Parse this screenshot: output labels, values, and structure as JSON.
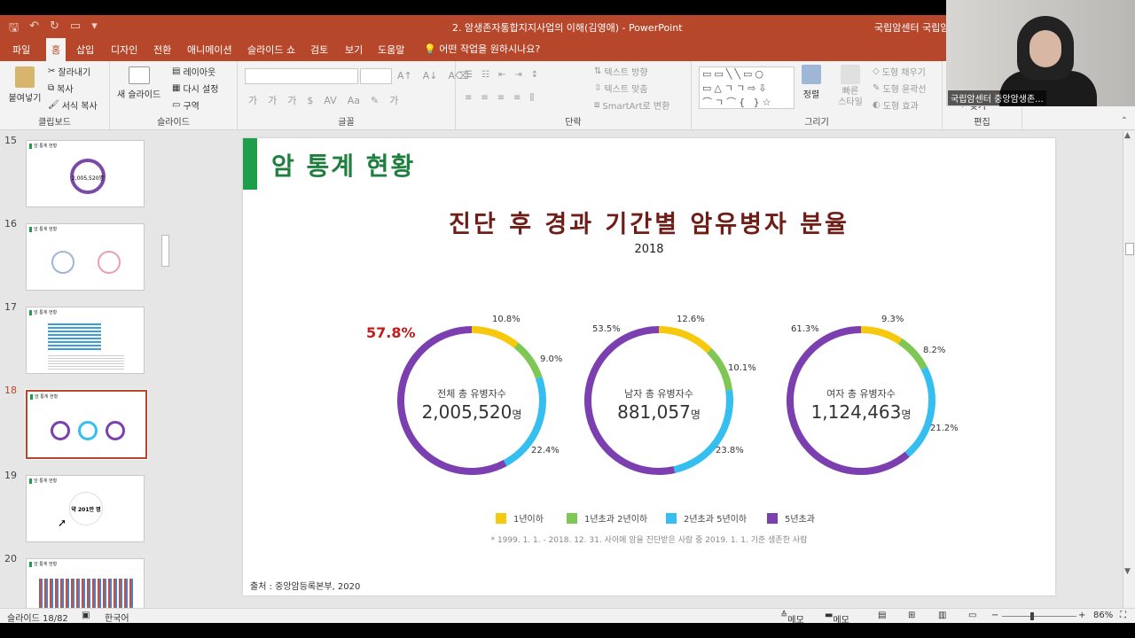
{
  "titlebar": {
    "document_title": "2. 암생존자통합지지사업의 이해(김영애)  -  PowerPoint",
    "account": "국립암센터 국립암"
  },
  "tabs": [
    "파일",
    "홈",
    "삽입",
    "디자인",
    "전환",
    "애니메이션",
    "슬라이드 쇼",
    "검토",
    "보기",
    "도움말"
  ],
  "tell_me": "어떤 작업을 원하시나요?",
  "ribbon": {
    "clipboard": {
      "paste": "붙여넣기",
      "cut": "잘라내기",
      "copy": "복사",
      "format_painter": "서식 복사",
      "label": "클립보드"
    },
    "slides": {
      "new_slide": "새 슬라이드",
      "layout": "레이아웃",
      "reset": "다시 설정",
      "section": "구역",
      "label": "슬라이드"
    },
    "font": {
      "label": "글꼴"
    },
    "paragraph": {
      "text_direction": "텍스트 방향",
      "align_text": "텍스트 맞춤",
      "smartart": "SmartArt로 변환",
      "label": "단락"
    },
    "drawing": {
      "arrange": "정렬",
      "quick_styles": "빠른 스타일",
      "shape_fill": "도형 채우기",
      "shape_outline": "도형 윤곽선",
      "shape_effects": "도형 효과",
      "label": "그리기"
    },
    "editing": {
      "label": "편집",
      "find": "찾기"
    }
  },
  "thumbnails": [
    {
      "num": "15",
      "title": "암 통계 현황",
      "center": "2,005,520명"
    },
    {
      "num": "16",
      "title": "암 통계 현황"
    },
    {
      "num": "17",
      "title": "암 통계 현황"
    },
    {
      "num": "18",
      "title": "암 통계 현황"
    },
    {
      "num": "19",
      "title": "암 통계 현황",
      "center": "약 201만 명"
    },
    {
      "num": "20",
      "title": "암 통계 현황"
    }
  ],
  "slide": {
    "header": "암 통계 현황",
    "chart_title": "진단 후 경과 기간별 암유병자 분율",
    "year": "2018",
    "highlight": "57.8%",
    "note": "* 1999. 1. 1. - 2018. 12. 31. 사이에 암을 진단받은 사람 중 2019. 1. 1. 기준 생존한 사람",
    "source": "출처 : 중앙암등록본부, 2020",
    "unit": "명"
  },
  "chart_data": {
    "type": "pie",
    "title": "진단 후 경과 기간별 암유병자 분율",
    "subtitle": "2018",
    "categories": [
      "1년이하",
      "1년초과 2년이하",
      "2년초과 5년이하",
      "5년초과"
    ],
    "colors": [
      "#f7c90e",
      "#7fc755",
      "#34bff0",
      "#7c3fb0"
    ],
    "series": [
      {
        "name": "전체 총 유병자수",
        "total": "2,005,520",
        "values": [
          10.8,
          9.0,
          22.4,
          57.8
        ],
        "labels": [
          "10.8%",
          "9.0%",
          "22.4%",
          "57.8%"
        ]
      },
      {
        "name": "남자 총 유병자수",
        "total": "881,057",
        "values": [
          12.6,
          10.1,
          23.8,
          53.5
        ],
        "labels": [
          "12.6%",
          "10.1%",
          "23.8%",
          "53.5%"
        ]
      },
      {
        "name": "여자 총 유병자수",
        "total": "1,124,463",
        "values": [
          9.3,
          8.2,
          21.2,
          61.3
        ],
        "labels": [
          "9.3%",
          "8.2%",
          "21.2%",
          "61.3%"
        ]
      }
    ]
  },
  "statusbar": {
    "slide": "슬라이드 18/82",
    "language": "한국어",
    "notes": "메모",
    "comments": "메모",
    "zoom": "86%"
  },
  "webcam": {
    "name": "국립암센터 중앙암생존..."
  }
}
